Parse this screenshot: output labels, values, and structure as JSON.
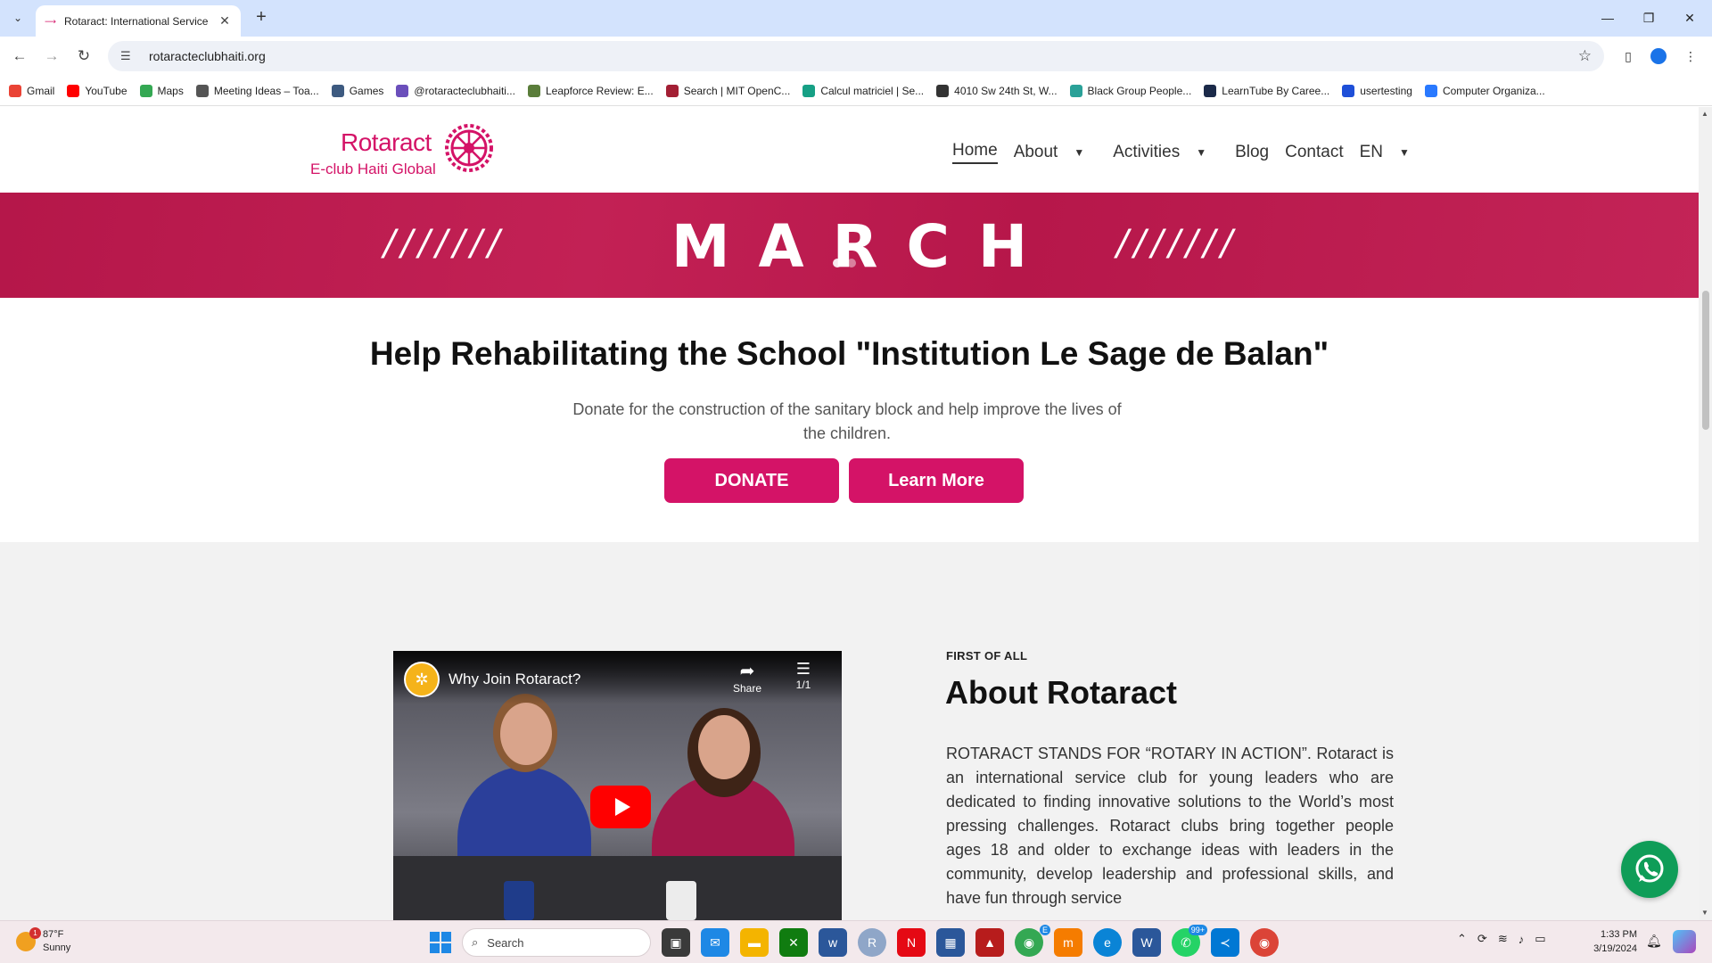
{
  "browser": {
    "tab_title": "Rotaract: International Service C",
    "new_tab": "+",
    "url": "rotaracteclubhaiti.org",
    "bookmarks": [
      {
        "label": "Gmail",
        "color": "#ea4335"
      },
      {
        "label": "YouTube",
        "color": "#ff0000"
      },
      {
        "label": "Maps",
        "color": "#34a853"
      },
      {
        "label": "Meeting Ideas – Toa...",
        "color": "#555555"
      },
      {
        "label": "Games",
        "color": "#3d5a80"
      },
      {
        "label": "@rotaracteclubhaiti...",
        "color": "#6b4fbb"
      },
      {
        "label": "Leapforce Review: E...",
        "color": "#5a7d3a"
      },
      {
        "label": "Search | MIT OpenC...",
        "color": "#a31f34"
      },
      {
        "label": "Calcul matriciel | Se...",
        "color": "#16a085"
      },
      {
        "label": "4010 Sw 24th St, W...",
        "color": "#333333"
      },
      {
        "label": "Black Group People...",
        "color": "#2aa198"
      },
      {
        "label": "LearnTube By Caree...",
        "color": "#1b2a49"
      },
      {
        "label": "usertesting",
        "color": "#1e4fd8"
      },
      {
        "label": "Computer Organiza...",
        "color": "#2979ff"
      }
    ]
  },
  "site": {
    "logo_word": "Rotaract",
    "logo_sub": "E-club Haiti Global",
    "nav": [
      {
        "label": "Home",
        "caret": false,
        "active": true
      },
      {
        "label": "About",
        "caret": true
      },
      {
        "label": "Activities",
        "caret": true
      },
      {
        "label": "Blog",
        "caret": false
      },
      {
        "label": "Contact",
        "caret": false
      },
      {
        "label": "EN",
        "caret": true
      }
    ],
    "banner_word": "MARCH",
    "banner_slashes": "///////",
    "hero": {
      "title": "Help Rehabilitating the School \"Institution Le Sage de Balan\"",
      "text": "Donate for the construction of the sanitary block and help improve the lives of the children.",
      "donate": "DONATE",
      "learn_more": "Learn More"
    },
    "about": {
      "eyebrow": "FIRST OF ALL",
      "title": "About Rotaract",
      "text": "ROTARACT STANDS FOR “ROTARY IN ACTION”. Rotaract is an international service club for young leaders who are dedicated to finding innovative solutions to the World’s most pressing challenges. Rotaract clubs bring together people ages 18 and older to exchange ideas with leaders in the community, develop leadership and professional skills, and have fun through service"
    },
    "video": {
      "title": "Why Join Rotaract?",
      "share": "Share",
      "playlist": "1/1"
    },
    "accent": "#d41367"
  },
  "taskbar": {
    "temp": "87°F",
    "condition": "Sunny",
    "weather_badge": "1",
    "search": "Search",
    "badge_e": "E",
    "badge_99": "99+",
    "time": "1:33 PM",
    "date": "3/19/2024"
  }
}
